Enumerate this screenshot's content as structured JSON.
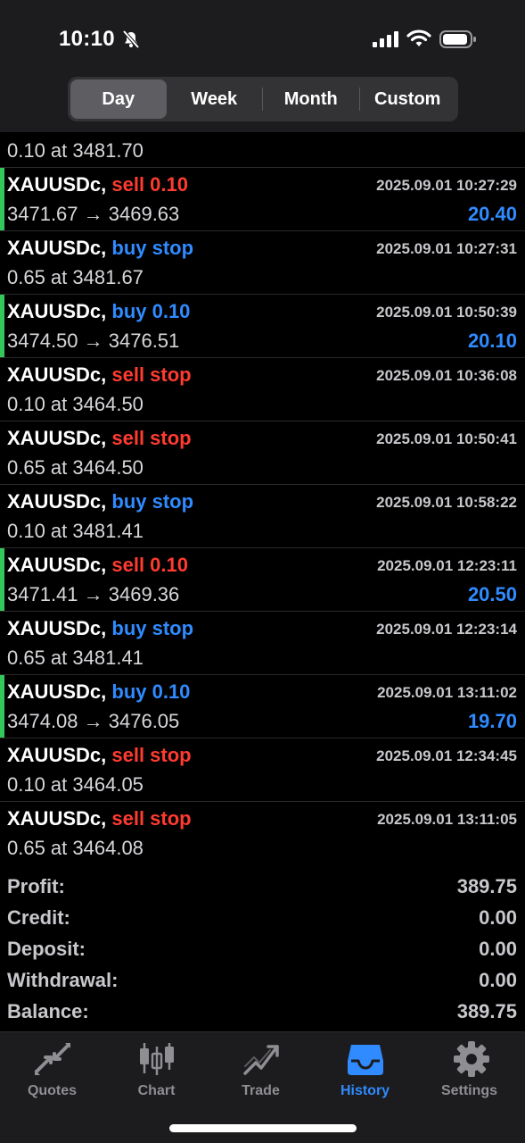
{
  "status_bar": {
    "time": "10:10"
  },
  "segments": [
    "Day",
    "Week",
    "Month",
    "Custom"
  ],
  "partial_order": {
    "line2": "0.10 at 3481.70"
  },
  "orders": [
    {
      "symbol": "XAUUSDc,",
      "type": "sell 0.10",
      "side": "sell",
      "time": "2025.09.01 10:27:29",
      "line2": "3471.67 → 3469.63",
      "profit": "20.40",
      "filled": true
    },
    {
      "symbol": "XAUUSDc,",
      "type": "buy stop",
      "side": "buy",
      "time": "2025.09.01 10:27:31",
      "line2": "0.65 at 3481.67",
      "profit": "",
      "filled": false
    },
    {
      "symbol": "XAUUSDc,",
      "type": "buy 0.10",
      "side": "buy",
      "time": "2025.09.01 10:50:39",
      "line2": "3474.50 → 3476.51",
      "profit": "20.10",
      "filled": true
    },
    {
      "symbol": "XAUUSDc,",
      "type": "sell stop",
      "side": "sell",
      "time": "2025.09.01 10:36:08",
      "line2": "0.10 at 3464.50",
      "profit": "",
      "filled": false
    },
    {
      "symbol": "XAUUSDc,",
      "type": "sell stop",
      "side": "sell",
      "time": "2025.09.01 10:50:41",
      "line2": "0.65 at 3464.50",
      "profit": "",
      "filled": false
    },
    {
      "symbol": "XAUUSDc,",
      "type": "buy stop",
      "side": "buy",
      "time": "2025.09.01 10:58:22",
      "line2": "0.10 at 3481.41",
      "profit": "",
      "filled": false
    },
    {
      "symbol": "XAUUSDc,",
      "type": "sell 0.10",
      "side": "sell",
      "time": "2025.09.01 12:23:11",
      "line2": "3471.41 → 3469.36",
      "profit": "20.50",
      "filled": true
    },
    {
      "symbol": "XAUUSDc,",
      "type": "buy stop",
      "side": "buy",
      "time": "2025.09.01 12:23:14",
      "line2": "0.65 at 3481.41",
      "profit": "",
      "filled": false
    },
    {
      "symbol": "XAUUSDc,",
      "type": "buy 0.10",
      "side": "buy",
      "time": "2025.09.01 13:11:02",
      "line2": "3474.08 → 3476.05",
      "profit": "19.70",
      "filled": true
    },
    {
      "symbol": "XAUUSDc,",
      "type": "sell stop",
      "side": "sell",
      "time": "2025.09.01 12:34:45",
      "line2": "0.10 at 3464.05",
      "profit": "",
      "filled": false
    },
    {
      "symbol": "XAUUSDc,",
      "type": "sell stop",
      "side": "sell",
      "time": "2025.09.01 13:11:05",
      "line2": "0.65 at 3464.08",
      "profit": "",
      "filled": false
    }
  ],
  "summary": [
    {
      "label": "Profit:",
      "value": "389.75"
    },
    {
      "label": "Credit:",
      "value": "0.00"
    },
    {
      "label": "Deposit:",
      "value": "0.00"
    },
    {
      "label": "Withdrawal:",
      "value": "0.00"
    },
    {
      "label": "Balance:",
      "value": "389.75"
    }
  ],
  "tabs": [
    {
      "label": "Quotes",
      "icon": "quotes-icon"
    },
    {
      "label": "Chart",
      "icon": "chart-icon"
    },
    {
      "label": "Trade",
      "icon": "trade-icon"
    },
    {
      "label": "History",
      "icon": "history-icon"
    },
    {
      "label": "Settings",
      "icon": "settings-icon"
    }
  ],
  "colors": {
    "buy": "#2f8bff",
    "sell": "#ff3b30",
    "filled_marker": "#34c759",
    "active_tab": "#2f8bff"
  }
}
